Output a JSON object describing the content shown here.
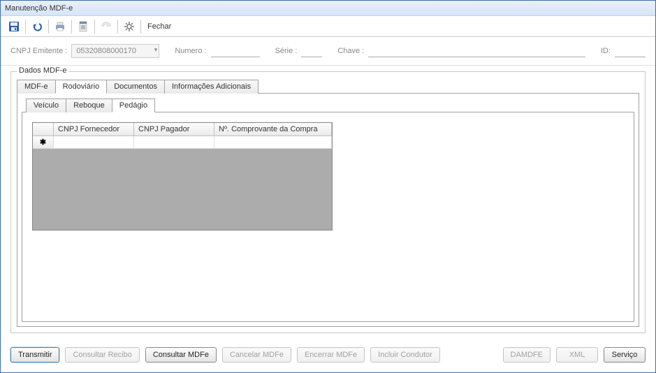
{
  "window": {
    "title": "Manutenção MDF-e"
  },
  "toolbar": {
    "close_label": "Fechar"
  },
  "filter": {
    "cnpj_label": "CNPJ Emitente :",
    "cnpj_value": "05320808000170",
    "numero_label": "Numero :",
    "numero_value": "",
    "serie_label": "Série :",
    "serie_value": "",
    "chave_label": "Chave :",
    "chave_value": "",
    "id_label": "ID:",
    "id_value": ""
  },
  "groupbox": {
    "title": "Dados MDF-e"
  },
  "tabs_outer": [
    "MDF-e",
    "Rodoviário",
    "Documentos",
    "Informações Adicionais"
  ],
  "tabs_outer_active": 1,
  "tabs_inner": [
    "Veículo",
    "Reboque",
    "Pedágio"
  ],
  "tabs_inner_active": 2,
  "grid": {
    "columns": [
      "CNPJ Fornecedor",
      "CNPJ Pagador",
      "Nº. Comprovante da Compra"
    ],
    "rows": [
      {
        "new": true,
        "cells": [
          "",
          "",
          ""
        ]
      }
    ]
  },
  "footer": {
    "transmitir": "Transmitir",
    "consultar_recibo": "Consultar Recibo",
    "consultar_mdfe": "Consultar MDFe",
    "cancelar_mdfe": "Cancelar MDFe",
    "encerrar_mdfe": "Encerrar MDFe",
    "incluir_condutor": "Incluir Condutor",
    "damdfe": "DAMDFE",
    "xml": "XML",
    "servico": "Serviço"
  }
}
